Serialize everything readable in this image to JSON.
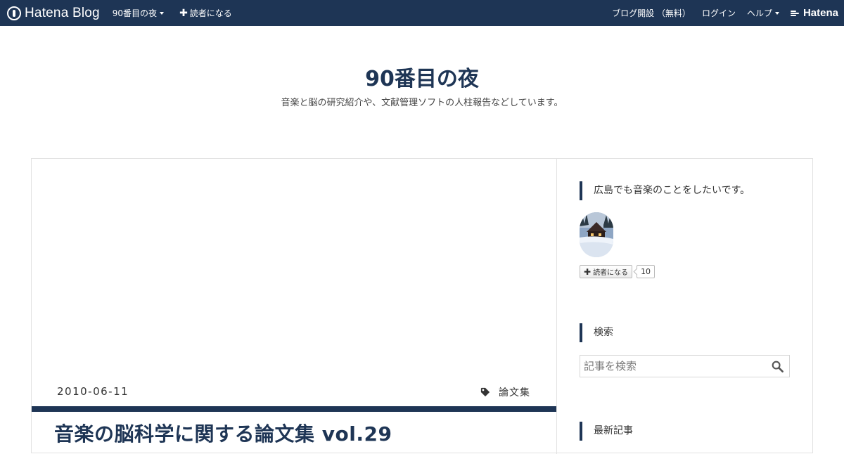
{
  "topbar": {
    "brand": "Hatena Blog",
    "blog_menu": "90番目の夜",
    "subscribe": "読者になる",
    "signup": "ブログ開設 （無料）",
    "login": "ログイン",
    "help": "ヘルプ",
    "hatena": "Hatena",
    "bg_color": "#1e3555"
  },
  "header": {
    "title": "90番目の夜",
    "description": "音楽と脳の研究紹介や、文献管理ソフトの人柱報告などしています。"
  },
  "entry": {
    "date": "2010-06-11",
    "category": "論文集",
    "title": "音楽の脳科学に関する論文集 vol.29"
  },
  "sidebar": {
    "profile_title": "広島でも音楽のことをしたいです。",
    "subscribe_button": "読者になる",
    "subscriber_count": "10",
    "search_title": "検索",
    "search_placeholder": "記事を検索",
    "recent_title": "最新記事"
  },
  "icons": {
    "brand": "hatena-blog-logo-icon",
    "tag": "tag-icon",
    "search": "search-icon",
    "plus": "plus-icon"
  },
  "colors": {
    "accent": "#1e3555"
  }
}
